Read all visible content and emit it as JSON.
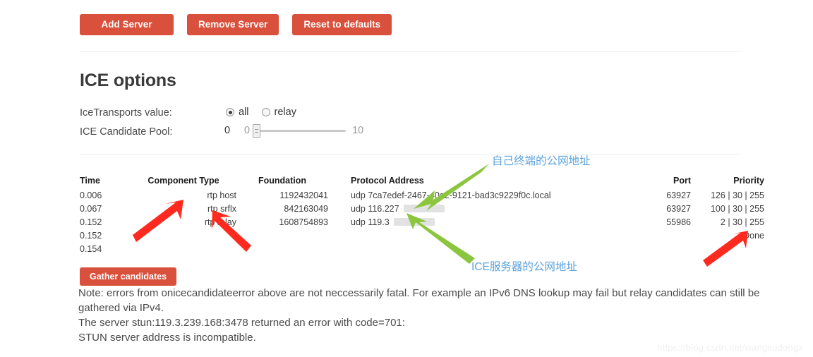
{
  "toolbar": {
    "add_server_label": "Add Server",
    "remove_server_label": "Remove Server",
    "reset_defaults_label": "Reset to defaults"
  },
  "ice_options": {
    "title": "ICE options",
    "transports": {
      "label": "IceTransports value:",
      "options": [
        {
          "label": "all",
          "checked": true
        },
        {
          "label": "relay",
          "checked": false
        }
      ]
    },
    "candidate_pool": {
      "label": "ICE Candidate Pool:",
      "value": "0",
      "min": "0",
      "max": "10"
    }
  },
  "candidates_table": {
    "headers": [
      "Time",
      "Component Type",
      "Foundation",
      "Protocol Address",
      "Port",
      "Priority"
    ],
    "rows": [
      {
        "time": "0.006",
        "component": "rtp host",
        "foundation": "1192432041",
        "protocol": "udp",
        "address": "7ca7edef-2467-40a2-9121-bad3c9229f0c.local",
        "address_redacted": false,
        "port": "63927",
        "priority": "126 | 30 | 255"
      },
      {
        "time": "0.067",
        "component": "rtp srflx",
        "foundation": "842163049",
        "protocol": "udp",
        "address": "116.227",
        "address_redacted": true,
        "port": "63927",
        "priority": "100 | 30 | 255"
      },
      {
        "time": "0.152",
        "component": "rtp relay",
        "foundation": "1608754893",
        "protocol": "udp",
        "address": "119.3",
        "address_redacted": true,
        "port": "55986",
        "priority": "2 | 30 | 255"
      },
      {
        "time": "0.152",
        "component": "",
        "foundation": "",
        "protocol": "",
        "address": "",
        "address_redacted": false,
        "port": "",
        "priority": "Done"
      },
      {
        "time": "0.154",
        "component": "",
        "foundation": "",
        "protocol": "",
        "address": "",
        "address_redacted": false,
        "port": "",
        "priority": ""
      }
    ]
  },
  "gather": {
    "button_label": "Gather candidates",
    "note_line1": "Note: errors from onicecandidateerror above are not neccessarily fatal. For example an IPv6 DNS lookup may fail but relay candidates can still be gathered via IPv4.",
    "note_line2": "The server stun:119.3.239.168:3478 returned an error with code=701:",
    "note_line3": "STUN server address is incompatible."
  },
  "annotations": {
    "client_public_address": "自己终端的公网地址",
    "ice_server_public_address": "ICE服务器的公网地址",
    "arrow_red_color": "#ff2a1f",
    "arrow_green_color": "#8cc63f",
    "annotation_text_color": "#5ba3dd"
  },
  "watermark": {
    "text": "https://blog.csdn.net/wangxudongx"
  },
  "theme": {
    "accent": "#d9503c",
    "divider": "#ececec"
  }
}
